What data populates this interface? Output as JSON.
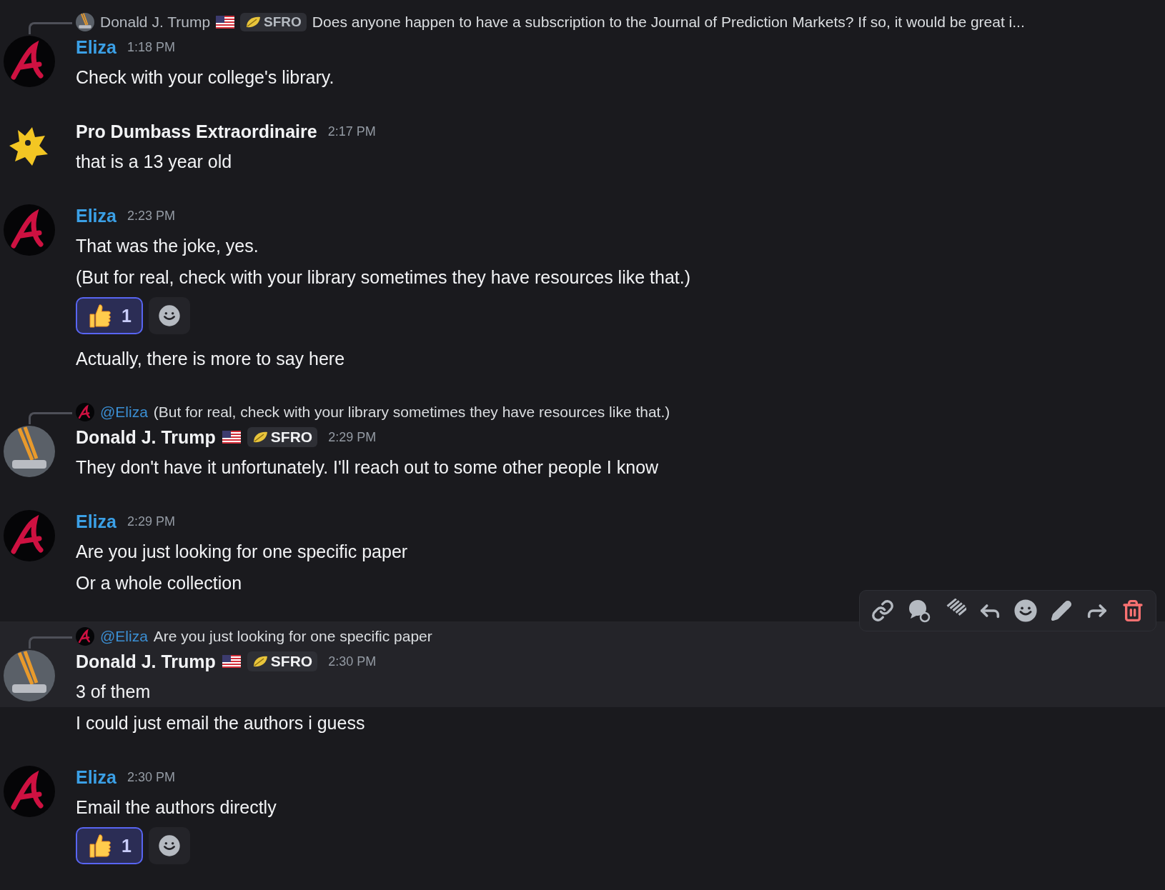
{
  "messages": [
    {
      "reply": {
        "avatar": {
          "kind": "photo"
        },
        "author": "Donald J. Trump",
        "mention": false,
        "flag": {
          "kind": "us"
        },
        "tag": "SFRO",
        "text": "Does anyone happen to have a subscription to the Journal of Prediction Markets? If so, it would be great i..."
      },
      "avatar": {
        "kind": "logo"
      },
      "author": {
        "name": "Eliza",
        "color": "#3ba0e6"
      },
      "time": "1:18 PM",
      "text": "Check with your college's library.",
      "hovered": false
    },
    {
      "avatar": {
        "kind": "creature"
      },
      "author": {
        "name": "Pro Dumbass Extraordinaire",
        "color": "#f2f3f5"
      },
      "time": "2:17 PM",
      "text": "that is a 13 year old",
      "hovered": false
    },
    {
      "avatar": {
        "kind": "logo"
      },
      "author": {
        "name": "Eliza",
        "color": "#3ba0e6"
      },
      "time": "2:23 PM",
      "text": "That was the joke, yes.",
      "hovered": false
    },
    {
      "text": "(But for real, check with your library sometimes they have resources like that.)",
      "reactions": [
        {
          "count": "1",
          "selected": true
        }
      ],
      "hovered": false
    },
    {
      "text": "Actually, there is more to say here",
      "hovered": false
    },
    {
      "reply": {
        "avatar": {
          "kind": "logo"
        },
        "author": "@Eliza",
        "mention": true,
        "text": "(But for real, check with your library sometimes they have resources like that.)"
      },
      "avatar": {
        "kind": "photo"
      },
      "author": {
        "name": "Donald J. Trump",
        "color": "#f2f3f5"
      },
      "flag": {
        "kind": "us"
      },
      "tag": "SFRO",
      "time": "2:29 PM",
      "text": "They don't have it unfortunately. I'll reach out to some other people I know",
      "hovered": false
    },
    {
      "avatar": {
        "kind": "logo"
      },
      "author": {
        "name": "Eliza",
        "color": "#3ba0e6"
      },
      "time": "2:29 PM",
      "text": "Are you just looking for one specific paper",
      "hovered": false
    },
    {
      "text": "Or a whole collection",
      "hovered": false
    },
    {
      "reply": {
        "avatar": {
          "kind": "logo"
        },
        "author": "@Eliza",
        "mention": true,
        "text": "Are you just looking for one specific paper"
      },
      "avatar": {
        "kind": "photo"
      },
      "author": {
        "name": "Donald J. Trump",
        "color": "#f2f3f5"
      },
      "flag": {
        "kind": "us"
      },
      "tag": "SFRO",
      "time": "2:30 PM",
      "text": "3 of them",
      "hovered": true
    },
    {
      "text": "I could just email the authors i guess",
      "hovered": false
    },
    {
      "avatar": {
        "kind": "logo"
      },
      "author": {
        "name": "Eliza",
        "color": "#3ba0e6"
      },
      "time": "2:30 PM",
      "text": "Email the authors directly",
      "reactions": [
        {
          "count": "1",
          "selected": true
        }
      ],
      "hovered": false
    }
  ]
}
